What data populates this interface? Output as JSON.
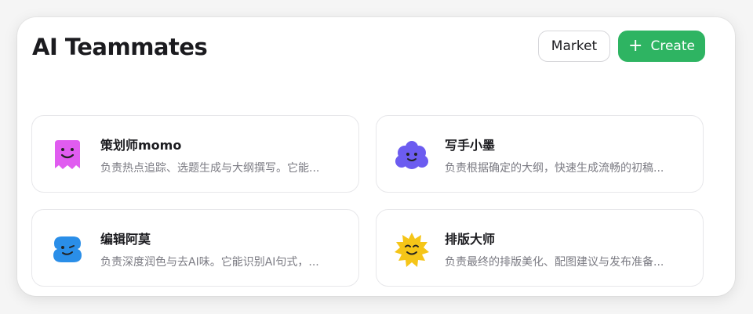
{
  "header": {
    "title": "AI Teammates",
    "market_label": "Market",
    "create_label": "Create",
    "create_icon": "plus-icon"
  },
  "colors": {
    "create_button": "#2eb462",
    "avatar_momo": "#e05cf0",
    "avatar_xiaomo": "#6c5cf0",
    "avatar_amo": "#2a8ee8",
    "avatar_dashi": "#f5c518"
  },
  "cards": [
    {
      "name": "策划师momo",
      "description": "负责热点追踪、选题生成与大纲撰写。它能...",
      "icon": "pink-ghost-avatar"
    },
    {
      "name": "写手小墨",
      "description": "负责根据确定的大纲，快速生成流畅的初稿...",
      "icon": "purple-cloud-avatar"
    },
    {
      "name": "编辑阿莫",
      "description": "负责深度润色与去AI味。它能识别AI句式，...",
      "icon": "blue-blob-avatar"
    },
    {
      "name": "排版大师",
      "description": "负责最终的排版美化、配图建议与发布准备...",
      "icon": "yellow-sun-avatar"
    }
  ]
}
